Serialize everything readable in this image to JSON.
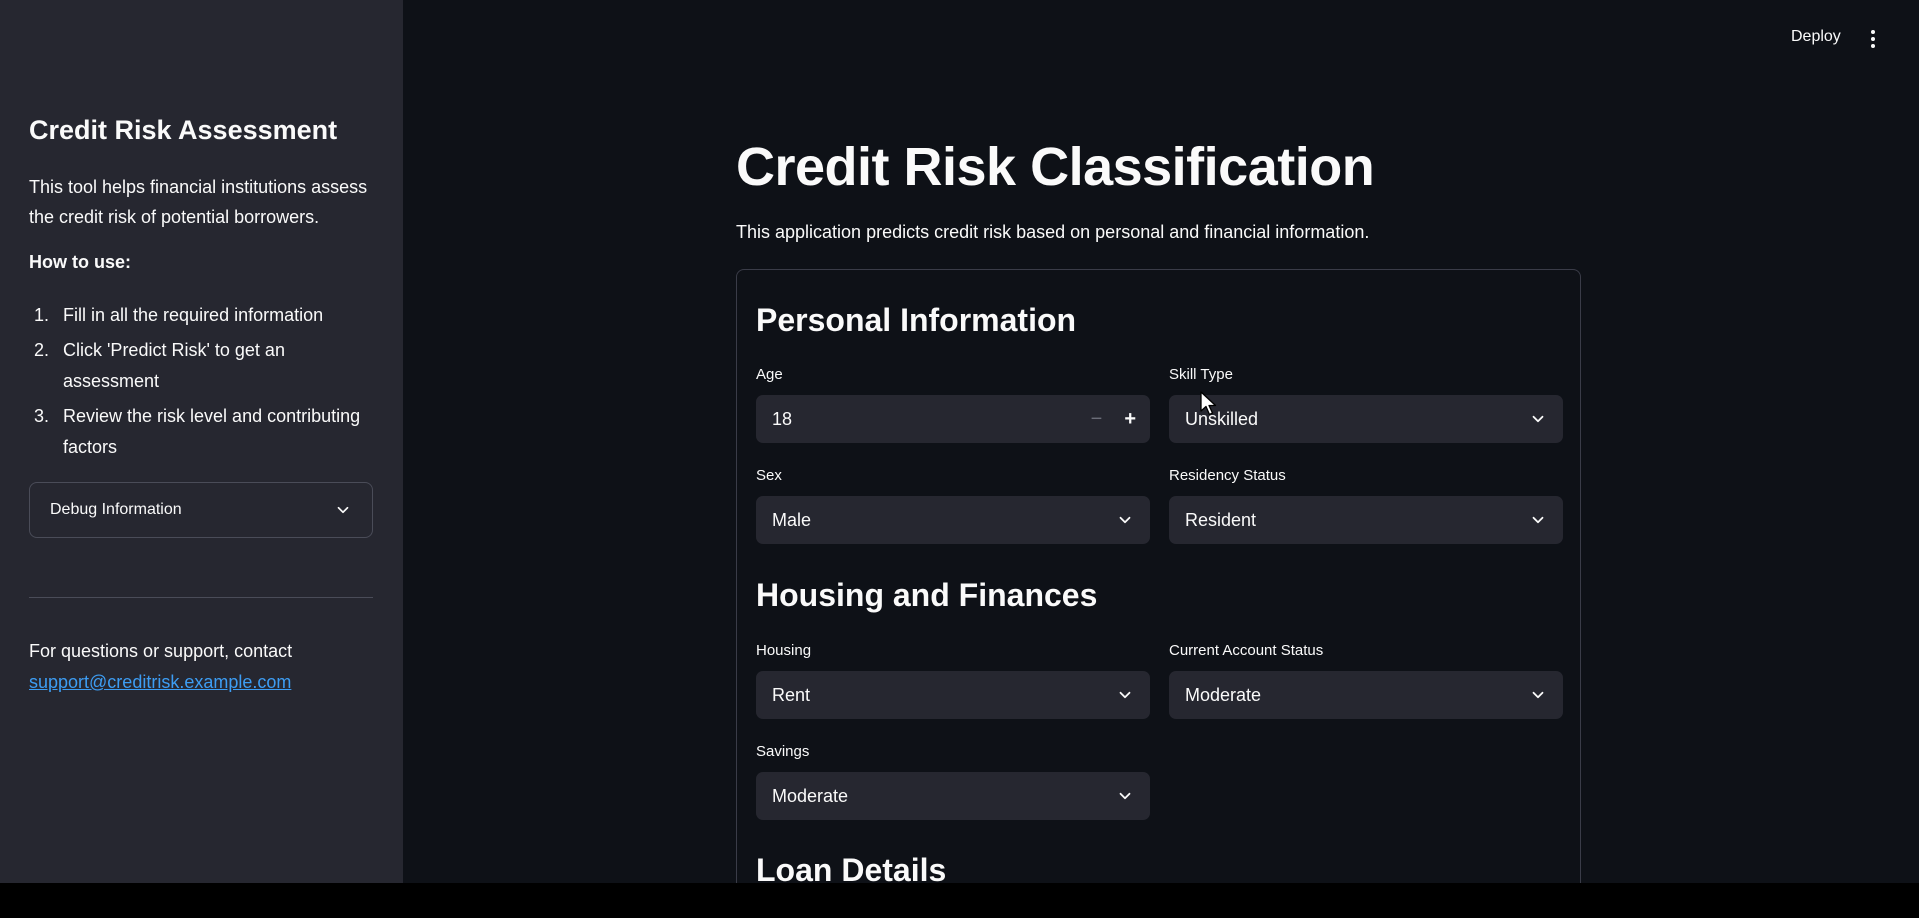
{
  "sidebar": {
    "title": "Credit Risk Assessment",
    "description": "This tool helps financial institutions assess the credit risk of potential borrowers.",
    "how_to_label": "How to use:",
    "steps": [
      {
        "num": "1.",
        "text": "Fill in all the required information"
      },
      {
        "num": "2.",
        "text": "Click 'Predict Risk' to get an assessment"
      },
      {
        "num": "3.",
        "text": "Review the risk level and contributing factors"
      }
    ],
    "debug_label": "Debug Information",
    "contact_text": "For questions or support, contact",
    "contact_email": "support@creditrisk.example.com"
  },
  "header": {
    "deploy_label": "Deploy"
  },
  "main": {
    "title": "Credit Risk Classification",
    "subtitle": "This application predicts credit risk based on personal and financial information.",
    "sections": {
      "personal": "Personal Information",
      "housing": "Housing and Finances",
      "loan": "Loan Details"
    },
    "fields": {
      "age": {
        "label": "Age",
        "value": "18"
      },
      "skill_type": {
        "label": "Skill Type",
        "value": "Unskilled"
      },
      "sex": {
        "label": "Sex",
        "value": "Male"
      },
      "residency": {
        "label": "Residency Status",
        "value": "Resident"
      },
      "housing": {
        "label": "Housing",
        "value": "Rent"
      },
      "account_status": {
        "label": "Current Account Status",
        "value": "Moderate"
      },
      "savings": {
        "label": "Savings",
        "value": "Moderate"
      }
    }
  },
  "colors": {
    "sidebar_bg": "#262730",
    "main_bg": "#0e1117",
    "input_bg": "#262730",
    "link": "#3d9df3",
    "text": "#fafafa"
  },
  "icons": {
    "select_chevron": "chevron-down-icon",
    "menu": "kebab-menu-icon",
    "pointer": "mouse-cursor-icon"
  }
}
